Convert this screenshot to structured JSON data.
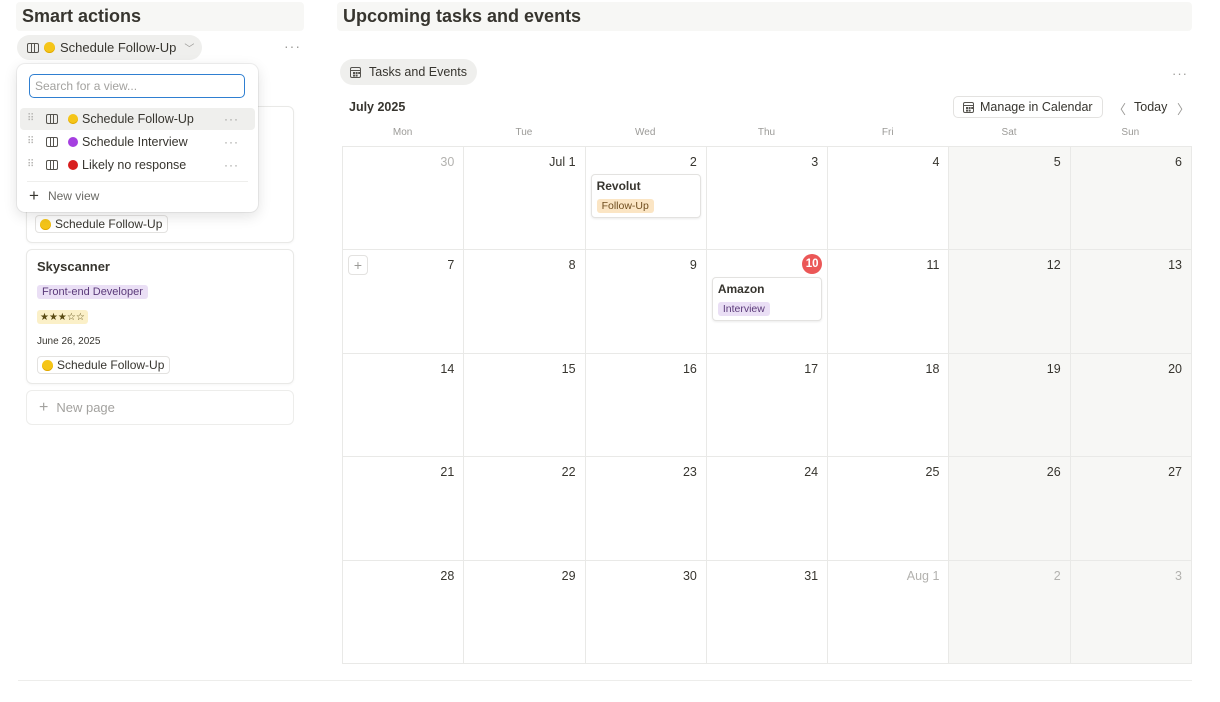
{
  "left": {
    "title": "Smart actions",
    "view_switch": {
      "label": "Schedule Follow-Up",
      "icon": "table-icon",
      "dot_color": "#f5c518"
    },
    "more": "···"
  },
  "dropdown": {
    "search_placeholder": "Search for a view...",
    "items": [
      {
        "label": "Schedule Follow-Up",
        "dot_color": "#f5c518",
        "active": true
      },
      {
        "label": "Schedule Interview",
        "dot_color": "#a53fe0",
        "active": false
      },
      {
        "label": "Likely no response",
        "dot_color": "#d81e1e",
        "active": false
      }
    ],
    "new_view": "New view"
  },
  "cards": [
    {
      "status": "Schedule Follow-Up"
    },
    {
      "title": "Skyscanner",
      "role": "Front-end Developer",
      "rating": "★★★☆☆",
      "date": "June 26, 2025",
      "status": "Schedule Follow-Up"
    }
  ],
  "new_page": "New page",
  "right": {
    "title": "Upcoming tasks and events",
    "tab": "Tasks and Events",
    "more": "···",
    "month": "July 2025",
    "manage": "Manage in Calendar",
    "today": "Today"
  },
  "weekdays": [
    "Mon",
    "Tue",
    "Wed",
    "Thu",
    "Fri",
    "Sat",
    "Sun"
  ],
  "weeks": [
    [
      "30",
      "Jul 1",
      "2",
      "3",
      "4",
      "5",
      "6"
    ],
    [
      "7",
      "8",
      "9",
      "10",
      "11",
      "12",
      "13"
    ],
    [
      "14",
      "15",
      "16",
      "17",
      "18",
      "19",
      "20"
    ],
    [
      "21",
      "22",
      "23",
      "24",
      "25",
      "26",
      "27"
    ],
    [
      "28",
      "29",
      "30",
      "31",
      "Aug 1",
      "2",
      "3"
    ]
  ],
  "events": [
    {
      "title": "Revolut",
      "tag": "Follow-Up"
    },
    {
      "title": "Amazon",
      "tag": "Interview"
    }
  ],
  "colors": {
    "today": "#eb5757",
    "accent": "#2f7fd1"
  }
}
